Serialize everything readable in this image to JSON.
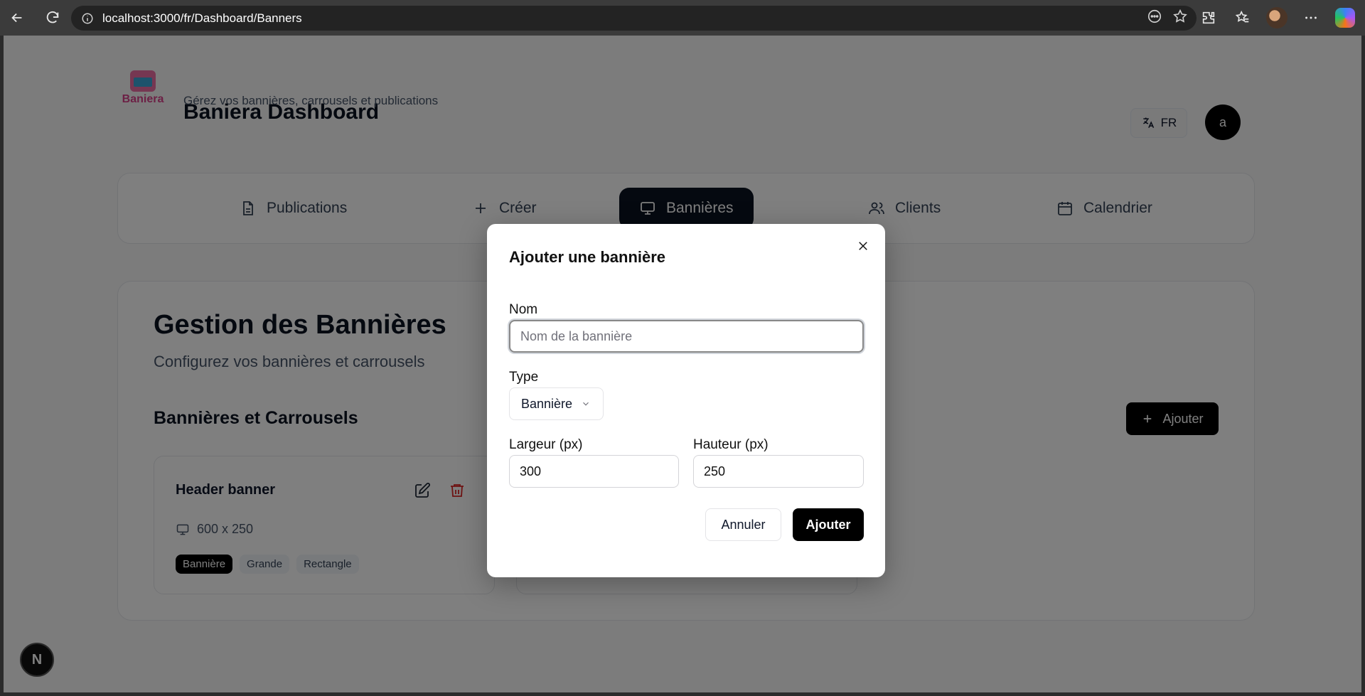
{
  "browser": {
    "url": "localhost:3000/fr/Dashboard/Banners"
  },
  "app": {
    "logo_text": "Baniera",
    "title": "Baniera Dashboard",
    "subtitle": "Gérez vos bannières, carrousels et publications",
    "lang": "FR",
    "avatar_initial": "a"
  },
  "nav": {
    "items": [
      {
        "label": "Publications",
        "icon": "file-icon"
      },
      {
        "label": "Créer",
        "icon": "plus-icon"
      },
      {
        "label": "Bannières",
        "icon": "monitor-icon"
      },
      {
        "label": "Clients",
        "icon": "users-icon"
      },
      {
        "label": "Calendrier",
        "icon": "calendar-icon"
      }
    ],
    "active": "Bannières"
  },
  "main": {
    "title": "Gestion des Bannières",
    "subtitle": "Configurez vos bannières et carrousels",
    "section_title": "Bannières et Carrousels",
    "add_label": "Ajouter",
    "cards": [
      {
        "title": "Header banner",
        "size": "600 x 250",
        "tags": [
          "Bannière",
          "Grande",
          "Rectangle"
        ]
      }
    ]
  },
  "modal": {
    "title": "Ajouter une bannière",
    "name_label": "Nom",
    "name_placeholder": "Nom de la bannière",
    "type_label": "Type",
    "type_value": "Bannière",
    "width_label": "Largeur (px)",
    "width_value": "300",
    "height_label": "Hauteur (px)",
    "height_value": "250",
    "cancel_label": "Annuler",
    "submit_label": "Ajouter"
  },
  "dev": {
    "badge": "N"
  }
}
